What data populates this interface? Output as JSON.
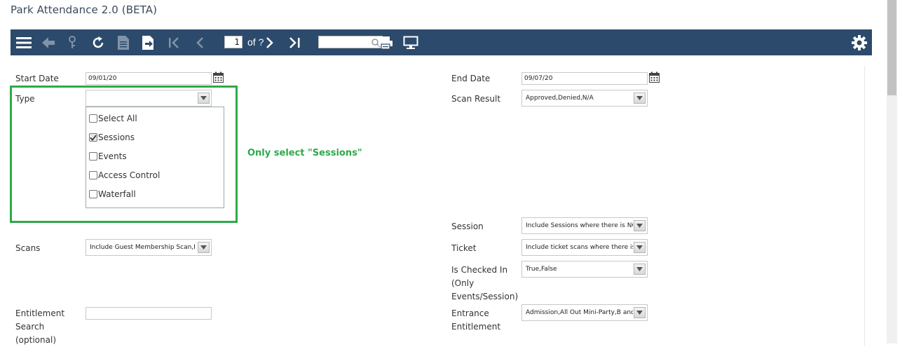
{
  "app": {
    "title": "Park Attendance 2.0 (BETA)"
  },
  "toolbar": {
    "page_number": "1",
    "page_of": "of ?",
    "search_value": "",
    "icons": [
      "menu-icon",
      "back-icon",
      "parameters-icon",
      "refresh-icon",
      "document-map-icon",
      "export-icon",
      "first-page-icon",
      "previous-page-icon",
      "next-page-icon",
      "last-page-icon",
      "search-icon",
      "print-icon",
      "display-icon",
      "settings-icon"
    ]
  },
  "params": {
    "start_date": {
      "label": "Start Date",
      "value": "09/01/20"
    },
    "end_date": {
      "label": "End Date",
      "value": "09/07/20"
    },
    "type": {
      "label": "Type",
      "value": "",
      "options": [
        {
          "label": "Select All",
          "checked": false
        },
        {
          "label": "Sessions",
          "checked": true
        },
        {
          "label": "Events",
          "checked": false
        },
        {
          "label": "Access Control",
          "checked": false
        },
        {
          "label": "Waterfall",
          "checked": false
        }
      ]
    },
    "scan_result": {
      "label": "Scan Result",
      "value": "Approved,Denied,N/A"
    },
    "session": {
      "label": "Session",
      "value": "Include Sessions where there is NO"
    },
    "scans": {
      "label": "Scans",
      "value": "Include Guest Membership Scan,In"
    },
    "ticket": {
      "label": "Ticket",
      "value": "Include ticket scans where there is"
    },
    "is_checked_in": {
      "label_lines": [
        "Is Checked In",
        "(Only",
        "Events/Session)"
      ],
      "value": "True,False"
    },
    "entitlement_search": {
      "label_lines": [
        "Entitlement",
        "Search",
        "(optional)"
      ],
      "value": ""
    },
    "entrance_entitlement": {
      "label_lines": [
        "Entrance",
        "Entitlement"
      ],
      "value": "Admission,All Out Mini-Party,B and"
    }
  },
  "annotation": {
    "text": "Only select \"Sessions\"",
    "color": "#2daa4a"
  },
  "colors": {
    "toolbar_bg": "#2c4a6b",
    "annotation": "#2daa4a"
  }
}
